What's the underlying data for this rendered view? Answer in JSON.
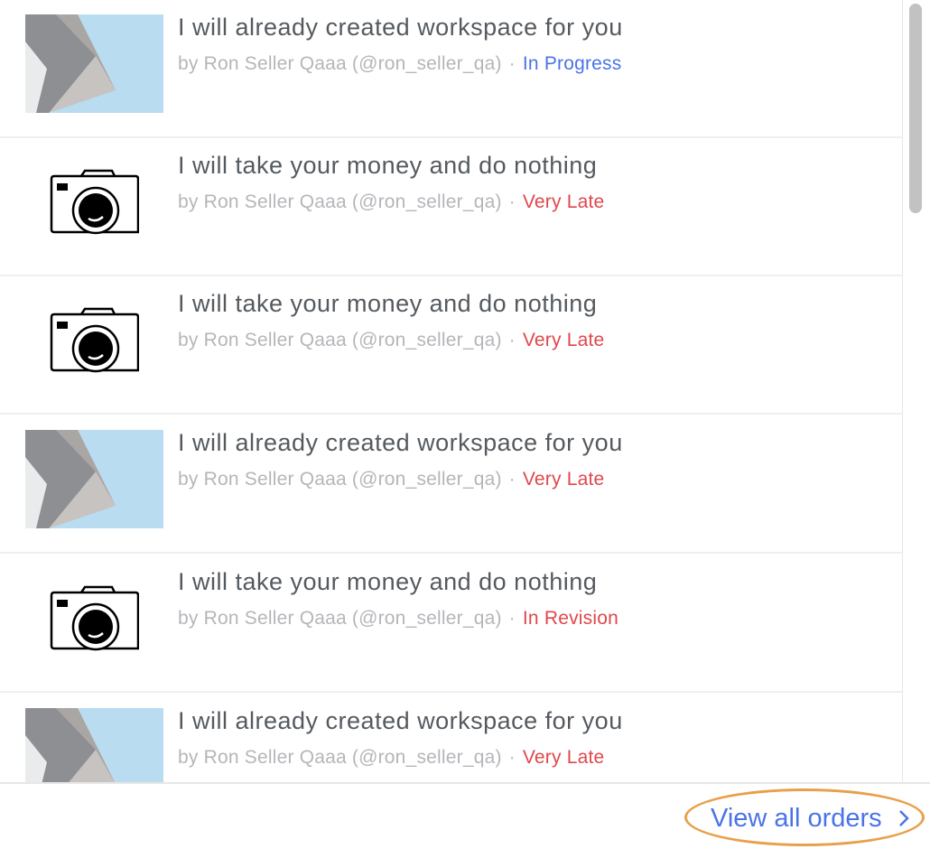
{
  "orders": [
    {
      "title": "I will already created workspace for you",
      "seller": "by Ron Seller Qaaa (@ron_seller_qa)",
      "separator": "·",
      "status": "In Progress",
      "status_color": "#4a73e8",
      "thumbnail": "architecture-photo"
    },
    {
      "title": "I will take your money and do nothing",
      "seller": "by Ron Seller Qaaa (@ron_seller_qa)",
      "separator": "·",
      "status": "Very Late",
      "status_color": "#e0474c",
      "thumbnail": "camera-icon"
    },
    {
      "title": "I will take your money and do nothing",
      "seller": "by Ron Seller Qaaa (@ron_seller_qa)",
      "separator": "·",
      "status": "Very Late",
      "status_color": "#e0474c",
      "thumbnail": "camera-icon"
    },
    {
      "title": "I will already created workspace for you",
      "seller": "by Ron Seller Qaaa (@ron_seller_qa)",
      "separator": "·",
      "status": "Very Late",
      "status_color": "#e0474c",
      "thumbnail": "architecture-photo"
    },
    {
      "title": "I will take your money and do nothing",
      "seller": "by Ron Seller Qaaa (@ron_seller_qa)",
      "separator": "·",
      "status": "In Revision",
      "status_color": "#e0474c",
      "thumbnail": "camera-icon"
    },
    {
      "title": "I will already created workspace for you",
      "seller": "by Ron Seller Qaaa (@ron_seller_qa)",
      "separator": "·",
      "status": "Very Late",
      "status_color": "#e0474c",
      "thumbnail": "architecture-photo"
    }
  ],
  "footer": {
    "view_all_label": "View all orders",
    "chevron_icon": "chevron-right-icon",
    "highlight_color": "#e8a04a"
  }
}
